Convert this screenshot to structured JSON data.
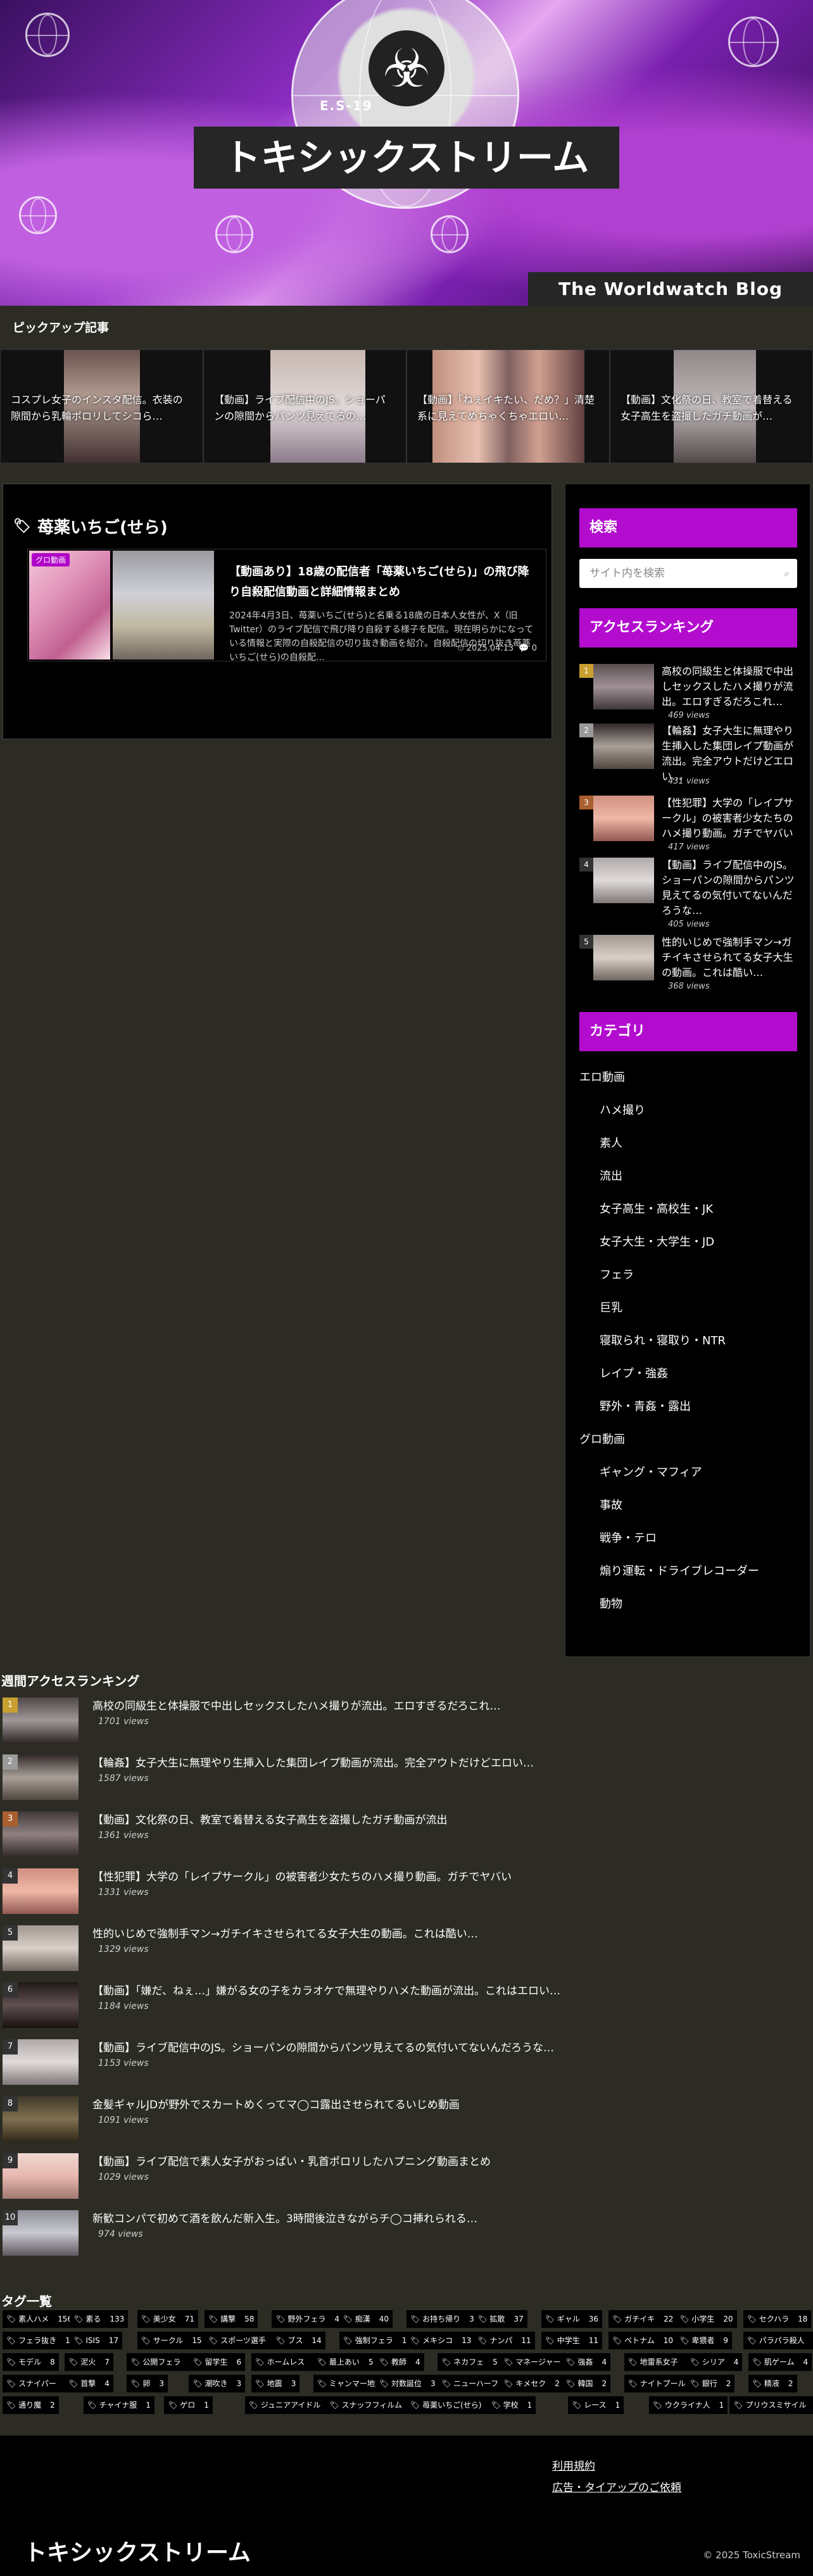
{
  "header": {
    "hazard_label": "E.S-19",
    "site_title": "トキシックストリーム",
    "tagline": "The Worldwatch Blog",
    "hazard_icon": "biohazard-icon"
  },
  "pickup": {
    "heading": "ピックアップ記事",
    "items": [
      "コスプレ女子のインスタ配信。衣装の隙間から乳輪ポロリしてシコら…",
      "【動画】ライブ配信中のJS。ショーパンの隙間からパンツ見えてるの…",
      "【動画】「ねぇイキたい、だめ？」清楚系に見えてめちゃくちゃエロい…",
      "【動画】文化祭の日、教室で着替える女子高生を盗撮したガチ動画が…"
    ]
  },
  "tag_archive": {
    "title": "苺薬いちご(せら)",
    "icon": "tags-icon"
  },
  "entry": {
    "badge": "グロ動画",
    "title": "【動画あり】18歳の配信者「苺薬いちご(せら)」の飛び降り自殺配信動画と詳細情報まとめ",
    "desc": "2024年4月3日、苺薬いちご(せら)と名乗る18歳の日本人女性が、X（旧Twitter）のライブ配信で飛び降り自殺する様子を配信。現在明らかになっている情報と実際の自殺配信の切り抜き動画を紹介。自殺配信の切り抜き苺薬いちご(せら)の自殺配…",
    "date": "2025.04.13",
    "comments": "0"
  },
  "sidebar": {
    "search_head": "検索",
    "search_placeholder": "サイト内を検索",
    "ranking_head": "アクセスランキング",
    "category_head": "カテゴリ",
    "ranking": [
      {
        "n": "1",
        "title": "高校の同級生と体操服で中出しセックスしたハメ撮りが流出。エロすぎるだろこれ…",
        "views": "469 views"
      },
      {
        "n": "2",
        "title": "【輪姦】女子大生に無理やり生挿入した集団レイプ動画が流出。完全アウトだけどエロい…",
        "views": "431 views"
      },
      {
        "n": "3",
        "title": "【性犯罪】大学の「レイプサークル」の被害者少女たちのハメ撮り動画。ガチでヤバい",
        "views": "417 views"
      },
      {
        "n": "4",
        "title": "【動画】ライブ配信中のJS。ショーパンの隙間からパンツ見えてるの気付いてないんだろうな…",
        "views": "405 views"
      },
      {
        "n": "5",
        "title": "性的いじめで強制手マン→ガチイキさせられてる女子大生の動画。これは酷い…",
        "views": "368 views"
      }
    ],
    "categories": [
      {
        "label": "エロ動画",
        "sub": false
      },
      {
        "label": "ハメ撮り",
        "sub": true
      },
      {
        "label": "素人",
        "sub": true
      },
      {
        "label": "流出",
        "sub": true
      },
      {
        "label": "女子高生・高校生・JK",
        "sub": true
      },
      {
        "label": "女子大生・大学生・JD",
        "sub": true
      },
      {
        "label": "フェラ",
        "sub": true
      },
      {
        "label": "巨乳",
        "sub": true
      },
      {
        "label": "寝取られ・寝取り・NTR",
        "sub": true
      },
      {
        "label": "レイプ・強姦",
        "sub": true
      },
      {
        "label": "野外・青姦・露出",
        "sub": true
      },
      {
        "label": "グロ動画",
        "sub": false
      },
      {
        "label": "ギャング・マフィア",
        "sub": true
      },
      {
        "label": "事故",
        "sub": true
      },
      {
        "label": "戦争・テロ",
        "sub": true
      },
      {
        "label": "煽り運転・ドライブレコーダー",
        "sub": true
      },
      {
        "label": "動物",
        "sub": true
      }
    ]
  },
  "weekly": {
    "heading": "週間アクセスランキング",
    "items": [
      {
        "n": "1",
        "title": "高校の同級生と体操服で中出しセックスしたハメ撮りが流出。エロすぎるだろこれ…",
        "views": "1701 views"
      },
      {
        "n": "2",
        "title": "【輪姦】女子大生に無理やり生挿入した集団レイプ動画が流出。完全アウトだけどエロい…",
        "views": "1587 views"
      },
      {
        "n": "3",
        "title": "【動画】文化祭の日、教室で着替える女子高生を盗撮したガチ動画が流出",
        "views": "1361 views"
      },
      {
        "n": "4",
        "title": "【性犯罪】大学の「レイプサークル」の被害者少女たちのハメ撮り動画。ガチでヤバい",
        "views": "1331 views"
      },
      {
        "n": "5",
        "title": "性的いじめで強制手マン→ガチイキさせられてる女子大生の動画。これは酷い…",
        "views": "1329 views"
      },
      {
        "n": "6",
        "title": "【動画】「嫌だ、ねぇ…」嫌がる女の子をカラオケで無理やりハメた動画が流出。これはエロい…",
        "views": "1184 views"
      },
      {
        "n": "7",
        "title": "【動画】ライブ配信中のJS。ショーパンの隙間からパンツ見えてるの気付いてないんだろうな…",
        "views": "1153 views"
      },
      {
        "n": "8",
        "title": "金髪ギャルJDが野外でスカートめくってマ◯コ露出させられてるいじめ動画",
        "views": "1091 views"
      },
      {
        "n": "9",
        "title": "【動画】ライブ配信で素人女子がおっぱい・乳首ポロリしたハプニング動画まとめ",
        "views": "1029 views"
      },
      {
        "n": "10",
        "title": "新歓コンパで初めて酒を飲んだ新入生。3時間後泣きながらチ◯コ挿れられる…",
        "views": "974 views"
      }
    ]
  },
  "tags": {
    "heading": "タグ一覧",
    "rows": [
      [
        [
          "素人ハメ",
          "156"
        ],
        [
          "素る",
          "133"
        ],
        [
          "美少女",
          "71"
        ],
        [
          "講撃",
          "58"
        ],
        [
          "野外フェラ",
          "44"
        ],
        [
          "痴漢",
          "40"
        ],
        [
          "お持ち帰り",
          "38"
        ],
        [
          "拡散",
          "37"
        ],
        [
          "ギャル",
          "36"
        ],
        [
          "ガチイキ",
          "22"
        ],
        [
          "小学生",
          "20"
        ],
        [
          "セクハラ",
          "18"
        ]
      ],
      [
        [
          "フェラ抜き",
          "17"
        ],
        [
          "ISIS",
          "17"
        ],
        [
          "サークル",
          "15"
        ],
        [
          "スポーツ選手",
          "14"
        ],
        [
          "ブス",
          "14"
        ],
        [
          "強制フェラ",
          "13"
        ],
        [
          "メキシコ",
          "13"
        ],
        [
          "ナンパ",
          "11"
        ],
        [
          "中学生",
          "11"
        ],
        [
          "ベトナム",
          "10"
        ],
        [
          "卑猥者",
          "9"
        ],
        [
          "パラパラ殺人",
          "8"
        ]
      ],
      [
        [
          "モデル",
          "8"
        ],
        [
          "泥火",
          "7"
        ],
        [
          "公開フェラ",
          "7"
        ],
        [
          "留学生",
          "6"
        ],
        [
          "ホームレス",
          "6"
        ],
        [
          "最上あい",
          "5"
        ],
        [
          "教師",
          "4"
        ],
        [
          "ネカフェ",
          "5"
        ],
        [
          "マネージャー",
          "4"
        ],
        [
          "強姦",
          "4"
        ],
        [
          "地雷系女子",
          "4"
        ],
        [
          "シリア",
          "4"
        ],
        [
          "肌ゲーム",
          "4"
        ]
      ],
      [
        [
          "スナイパー",
          "4"
        ],
        [
          "首撃",
          "4"
        ],
        [
          "卵",
          "3"
        ],
        [
          "潮吹き",
          "3"
        ],
        [
          "地震",
          "3"
        ],
        [
          "ミャンマー地震",
          "3"
        ],
        [
          "対数誕位",
          "3"
        ],
        [
          "ニューハーフ",
          "2"
        ],
        [
          "キメセク",
          "2"
        ],
        [
          "韓国",
          "2"
        ],
        [
          "ナイトプール",
          "2"
        ],
        [
          "銀行",
          "2"
        ],
        [
          "精液",
          "2"
        ]
      ],
      [
        [
          "通り魔",
          "2"
        ],
        [
          "チャイナ服",
          "1"
        ],
        [
          "ゲロ",
          "1"
        ],
        [
          "ジュニアアイドル",
          "1"
        ],
        [
          "スナッフフィルム",
          "1"
        ],
        [
          "苺薬いちご(せら)",
          "1"
        ],
        [
          "学校",
          "1"
        ],
        [
          "レース",
          "1"
        ],
        [
          "ウクライナ人",
          "1"
        ],
        [
          "プリウスミサイル",
          "1"
        ]
      ]
    ]
  },
  "footer": {
    "links": [
      "利用規約",
      "広告・タイアップのご依頼"
    ],
    "logo": "トキシックストリーム",
    "copyright": "© 2025 ToxicStream"
  }
}
